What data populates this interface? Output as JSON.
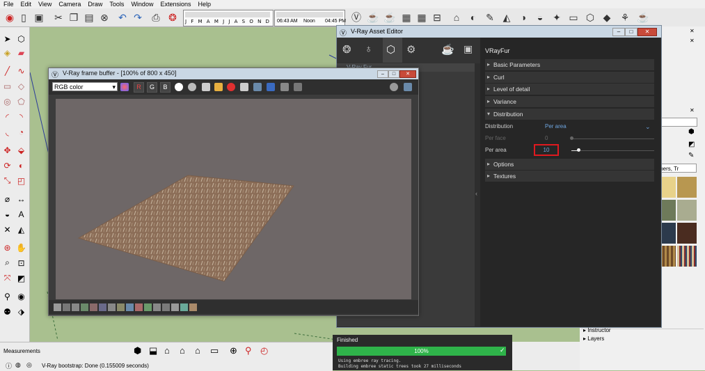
{
  "menu": [
    "File",
    "Edit",
    "View",
    "Camera",
    "Draw",
    "Tools",
    "Window",
    "Extensions",
    "Help"
  ],
  "toolbar": {
    "months_label": "J F M A M J J A S O N D",
    "time_start": "06:43 AM",
    "time_noon": "Noon",
    "time_end": "04:45 PM"
  },
  "vfb": {
    "title": "V-Ray frame buffer - [100% of 800 x 450]",
    "channel": "RGB color",
    "channels": [
      "R",
      "G",
      "B"
    ]
  },
  "asset_editor": {
    "title": "V-Ray Asset Editor",
    "asset_name": "V-Ray Fur",
    "panel_title": "VRayFur",
    "sections": [
      {
        "label": "Basic Parameters",
        "open": false
      },
      {
        "label": "Curl",
        "open": false
      },
      {
        "label": "Level of detail",
        "open": false
      },
      {
        "label": "Variance",
        "open": false
      },
      {
        "label": "Distribution",
        "open": true
      }
    ],
    "distribution": {
      "label": "Distribution",
      "value": "Per area",
      "per_face_label": "Per face",
      "per_face_value": "0",
      "per_area_label": "Per area",
      "per_area_value": "10"
    },
    "sections_after": [
      {
        "label": "Options"
      },
      {
        "label": "Textures"
      }
    ]
  },
  "right_panel": {
    "filter_text": "thers, Tr",
    "items": [
      "Instructor",
      "Layers"
    ]
  },
  "render_status": {
    "header": "Finished",
    "progress_text": "100%",
    "progress": 1.0,
    "log_lines": [
      "Using embree ray tracing.",
      "Building embree static trees took 27 milliseconds"
    ]
  },
  "bottom": {
    "measurements_label": "Measurements",
    "status_text": "V-Ray bootstrap: Done (0.155009 seconds)"
  },
  "colors": {
    "grass": "#a9c08f",
    "dark_panel": "#2b2b2b",
    "accent_blue": "#6fa6e0",
    "progress_green": "#2fb34a",
    "highlight_red": "#e0191f"
  }
}
